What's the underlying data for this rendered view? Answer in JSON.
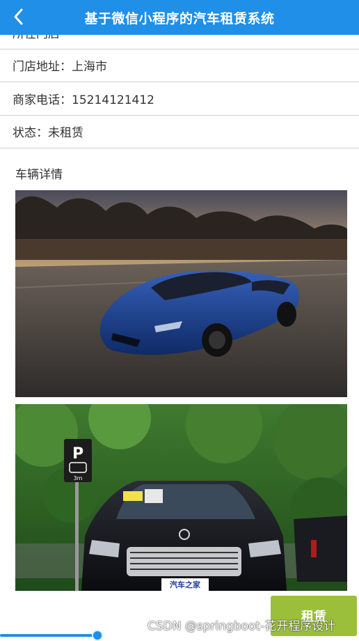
{
  "header": {
    "title": "基于微信小程序的汽车租赁系统",
    "back_icon": "chevron-left-icon",
    "background": "#1f8fe8"
  },
  "info": {
    "clipped_row_text": "所在门店",
    "store_address": "门店地址：上海市",
    "merchant_phone": "商家电话：15214121412",
    "status": "状态：未租赁"
  },
  "details": {
    "title": "车辆详情"
  },
  "actions": {
    "rent_label": "租赁",
    "rent_color": "#9bbf3a"
  },
  "watermark": "CSDN @springboot-花开程序设计"
}
